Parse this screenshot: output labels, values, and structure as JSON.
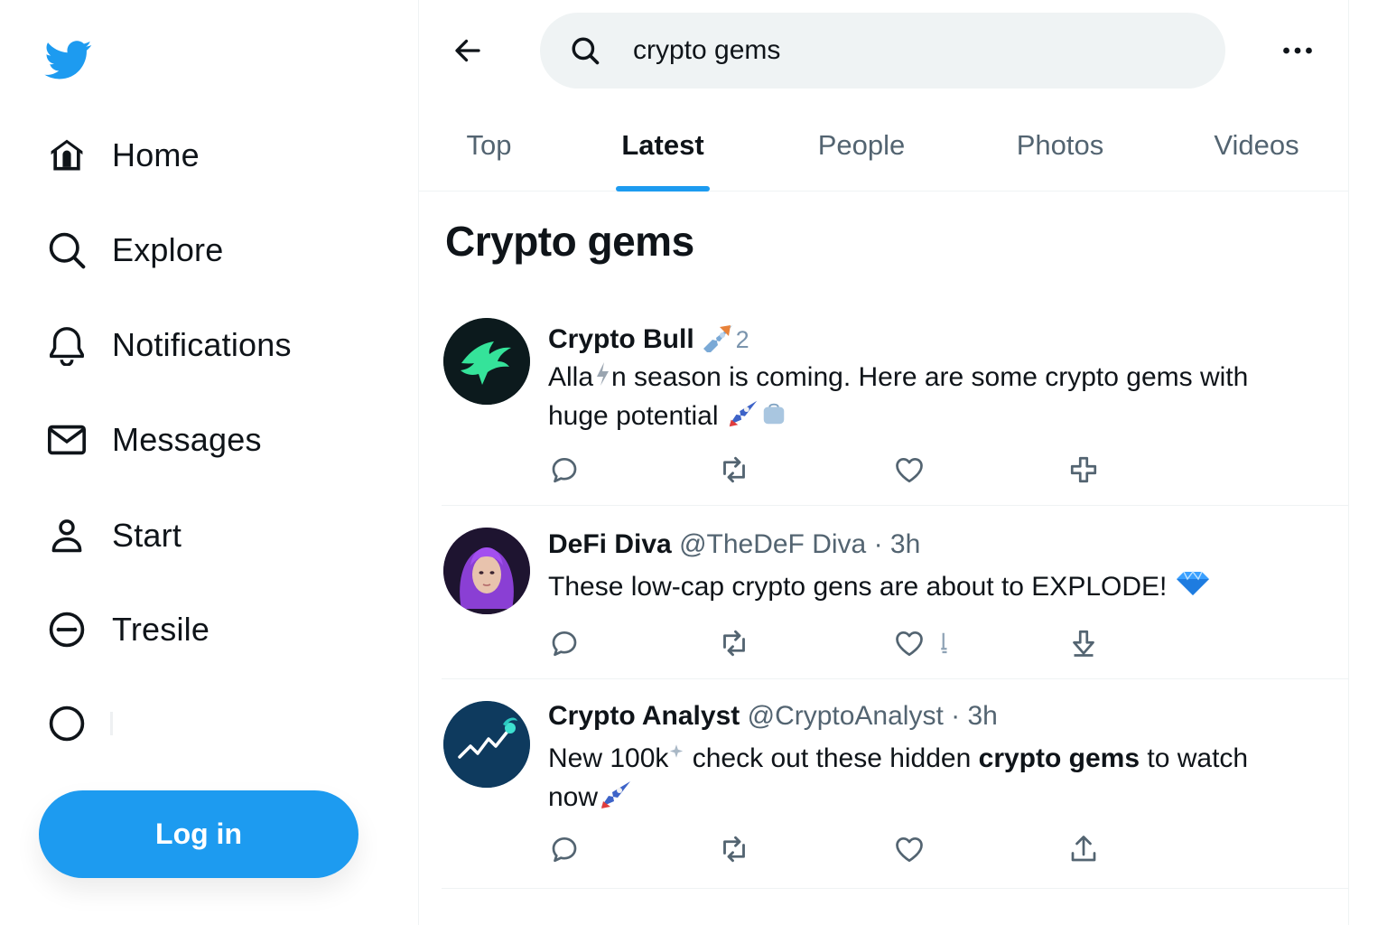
{
  "sidebar": {
    "logo": "twitter-bird-icon",
    "items": [
      {
        "label": "Home",
        "icon": "home-icon"
      },
      {
        "label": "Explore",
        "icon": "search-icon"
      },
      {
        "label": "Notifications",
        "icon": "bell-icon"
      },
      {
        "label": "Messages",
        "icon": "envelope-icon"
      },
      {
        "label": "Start",
        "icon": "person-icon"
      },
      {
        "label": "Tresile",
        "icon": "circle-dash-icon"
      },
      {
        "label": "",
        "icon": "circle-icon"
      }
    ],
    "login_label": "Log in"
  },
  "header": {
    "search_value": "crypto gems",
    "tabs": [
      {
        "label": "Top"
      },
      {
        "label": "Latest",
        "active": true
      },
      {
        "label": "People"
      },
      {
        "label": "Photos"
      },
      {
        "label": "Videos"
      }
    ]
  },
  "main": {
    "section_title": "Crypto gems",
    "tweets": [
      {
        "name": "Crypto Bull",
        "name_suffix": "2",
        "handle": "",
        "text_line1": "Alla",
        "text_line1b": "n season is coming. Here are some crypto gems with",
        "text_line2": "huge potential"
      },
      {
        "name": "DeFi Diva",
        "handle": "@TheDeF Diva · 3h",
        "text_line1": "These low-cap crypto gens are about to EXPLODE!"
      },
      {
        "name": "Crypto Analyst",
        "handle": "@CryptoAnalyst · 3h",
        "text_a": "New 100k",
        "text_b": " check out these hidden ",
        "text_bold": "crypto gems",
        "text_c": " to watch",
        "text_line2": "now"
      }
    ]
  },
  "colors": {
    "accent": "#1d9bf0",
    "text": "#0f1419",
    "muted": "#536471",
    "border": "#eff3f4"
  }
}
